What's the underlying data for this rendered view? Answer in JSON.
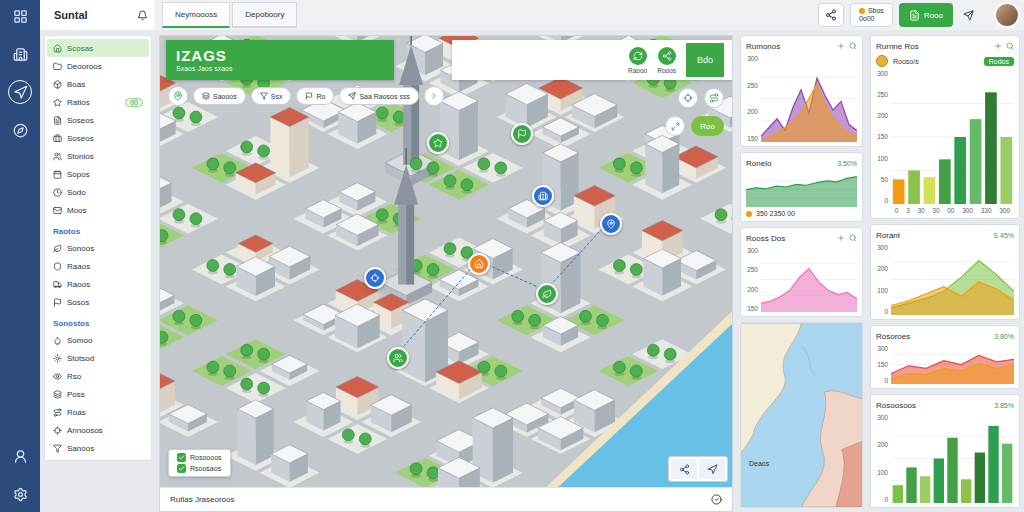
{
  "app": {
    "title": "Suntal"
  },
  "rail": [
    {
      "selected": false
    },
    {
      "selected": false
    },
    {
      "selected": true
    },
    {
      "selected": false
    },
    {
      "selected": false
    },
    {
      "selected": false
    }
  ],
  "tabs": [
    {
      "label": "Neymoooss",
      "selected": true
    },
    {
      "label": "Depoboory",
      "selected": false
    }
  ],
  "header": {
    "status": {
      "line1": "Sbos",
      "line2": "0o00",
      "color": "#f39c12"
    },
    "button": "Rooo"
  },
  "sidebar": {
    "items": [
      {
        "kind": "item",
        "label": "Scosas",
        "selected": true
      },
      {
        "kind": "item",
        "label": "Deooroos",
        "selected": false
      },
      {
        "kind": "item",
        "label": "Boas",
        "selected": false
      },
      {
        "kind": "item",
        "label": "Ratios",
        "selected": false,
        "badge": "00"
      },
      {
        "kind": "item",
        "label": "Soseos",
        "selected": false
      },
      {
        "kind": "item",
        "label": "Soseos",
        "selected": false
      },
      {
        "kind": "item",
        "label": "Stonios",
        "selected": false
      },
      {
        "kind": "item",
        "label": "Sopos",
        "selected": false
      },
      {
        "kind": "item",
        "label": "Sodo",
        "selected": false
      },
      {
        "kind": "item",
        "label": "Moos",
        "selected": false
      },
      {
        "kind": "section",
        "label": "Raotos"
      },
      {
        "kind": "item",
        "label": "Sonoos",
        "selected": false
      },
      {
        "kind": "item",
        "label": "Raaos",
        "selected": false
      },
      {
        "kind": "item",
        "label": "Raoos",
        "selected": false
      },
      {
        "kind": "item",
        "label": "Sosos",
        "selected": false
      },
      {
        "kind": "section",
        "label": "Sonostos"
      },
      {
        "kind": "item",
        "label": "Somoo",
        "selected": false
      },
      {
        "kind": "item",
        "label": "Stotsod",
        "selected": false
      },
      {
        "kind": "item",
        "label": "Rso",
        "selected": false
      },
      {
        "kind": "item",
        "label": "Poss",
        "selected": false
      },
      {
        "kind": "item",
        "label": "Roas",
        "selected": false
      },
      {
        "kind": "item",
        "label": "Annoosos",
        "selected": false
      },
      {
        "kind": "item",
        "label": "Sanoos",
        "selected": false
      }
    ]
  },
  "map": {
    "title": "IZAGS",
    "subtitle": "Sxaos Jaos sxaos",
    "chips": [
      {
        "label": "Saooos"
      },
      {
        "label": "Ssx"
      },
      {
        "label": "Ro"
      },
      {
        "label": "Saa Raosos sss"
      }
    ],
    "tools": [
      {
        "label": "Raooo"
      },
      {
        "label": "Rooos"
      }
    ],
    "badge": "Bdo",
    "tag": "Roo",
    "legend": [
      {
        "label": "Rosoooos",
        "checked": true
      },
      {
        "label": "Rsoosaos",
        "checked": true
      }
    ],
    "pins": [
      {
        "color": "#2f6fd1"
      },
      {
        "color": "#2f6fd1"
      },
      {
        "color": "#f07f1e"
      },
      {
        "color": "#3aa845"
      },
      {
        "color": "#3aa845"
      },
      {
        "color": "#3aa845"
      },
      {
        "color": "#3aa845"
      },
      {
        "color": "#2f6fd1"
      }
    ],
    "footer": "Rutlas Jraseoroos"
  },
  "left_cards": [
    {
      "kind": "area",
      "title": "Rumonos",
      "ticks": [
        "300",
        "250",
        "200",
        "150"
      ],
      "series": [
        {
          "values": [
            160,
            175,
            190,
            170,
            210,
            240,
            200,
            260,
            230,
            205,
            220,
            180,
            170
          ],
          "color": "#8e44ad"
        },
        {
          "values": [
            150,
            158,
            165,
            175,
            185,
            200,
            225,
            250,
            215,
            190,
            175,
            165,
            160
          ],
          "color": "#f39c12"
        }
      ]
    },
    {
      "kind": "area",
      "title": "Ronelo",
      "value": "3.50%",
      "ticks": [],
      "series": [
        {
          "values": [
            20,
            22,
            21,
            24,
            23,
            26,
            25,
            28,
            30,
            29,
            33,
            35
          ],
          "color": "#2e9e4f"
        }
      ],
      "footer": {
        "text": "350 2350 00",
        "color": "#f39c12"
      }
    },
    {
      "kind": "area",
      "title": "Rooss Dos",
      "ticks": [
        "300",
        "250",
        "200",
        "150"
      ],
      "series": [
        {
          "values": [
            170,
            175,
            185,
            200,
            230,
            250,
            220,
            200,
            190,
            195,
            180
          ],
          "color": "#e86fb8"
        }
      ]
    },
    {
      "kind": "map",
      "label": "Deaos"
    }
  ],
  "right_cards": [
    {
      "kind": "bars",
      "title": "Rurnne Ros",
      "filter": {
        "chip": "Rooso/s",
        "badge": "Rodos"
      },
      "ticks": [
        "300",
        "250",
        "200",
        "150",
        "100",
        "50",
        "0"
      ],
      "bars": [
        {
          "value": 55,
          "color": "#f39c12"
        },
        {
          "value": 75,
          "color": "#8bc34a"
        },
        {
          "value": 60,
          "color": "#d4e157"
        },
        {
          "value": 100,
          "color": "#43a047"
        },
        {
          "value": 150,
          "color": "#2e9e4f"
        },
        {
          "value": 190,
          "color": "#66bb6a"
        },
        {
          "value": 250,
          "color": "#2e7d32"
        },
        {
          "value": 150,
          "color": "#9ccc65"
        }
      ],
      "x_labels": [
        "0",
        "3",
        "30",
        "30",
        "00",
        "300",
        "330",
        "300"
      ]
    },
    {
      "kind": "area",
      "title": "Rorant",
      "value": "S 45%",
      "ticks": [
        "300",
        "200",
        "100",
        "0"
      ],
      "series": [
        {
          "values": [
            30,
            50,
            70,
            100,
            160,
            230,
            170,
            100
          ],
          "color": "#7cc242"
        },
        {
          "values": [
            40,
            60,
            90,
            120,
            80,
            140,
            110,
            60
          ],
          "color": "#f39c12"
        }
      ]
    },
    {
      "kind": "area",
      "title": "Rosoroes",
      "value": "3.80%",
      "ticks": [
        "300",
        "150",
        "0"
      ],
      "series": [
        {
          "values": [
            80,
            140,
            120,
            180,
            150,
            220,
            170,
            190
          ],
          "color": "#e74c3c"
        },
        {
          "values": [
            40,
            80,
            70,
            120,
            100,
            160,
            120,
            140
          ],
          "color": "#f39c12"
        }
      ]
    },
    {
      "kind": "bars",
      "title": "Rosoosoos",
      "value": "3.85%",
      "ticks": [
        "300",
        "200",
        "100",
        "0"
      ],
      "bars": [
        {
          "value": 60,
          "color": "#7cc242"
        },
        {
          "value": 120,
          "color": "#43a047"
        },
        {
          "value": 90,
          "color": "#9ccc65"
        },
        {
          "value": 150,
          "color": "#2e9e4f"
        },
        {
          "value": 220,
          "color": "#43a047"
        },
        {
          "value": 80,
          "color": "#8bc34a"
        },
        {
          "value": 170,
          "color": "#2e7d32"
        },
        {
          "value": 260,
          "color": "#2e9e4f"
        },
        {
          "value": 200,
          "color": "#66bb6a"
        }
      ]
    }
  ]
}
